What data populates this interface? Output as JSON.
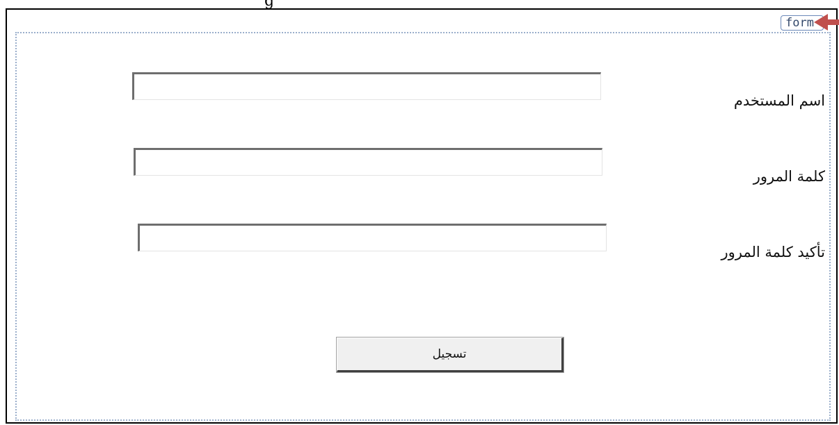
{
  "top_fragment": "g",
  "form": {
    "tag_label": "form"
  },
  "fields": [
    {
      "label": "اسم المستخدم",
      "value": "",
      "placeholder": ""
    },
    {
      "label": "كلمة  المرور",
      "value": "",
      "placeholder": ""
    },
    {
      "label": "تأكيد كلمة المرور",
      "value": "",
      "placeholder": ""
    }
  ],
  "submit": {
    "label": "تسجيل"
  },
  "colors": {
    "form_border": "#9aaecb",
    "form_tag_border": "#6a88b8",
    "arrow": "#c0504d",
    "button_face": "#f0f0f0"
  },
  "icons": {
    "pointer": "red-arrow-icon"
  }
}
